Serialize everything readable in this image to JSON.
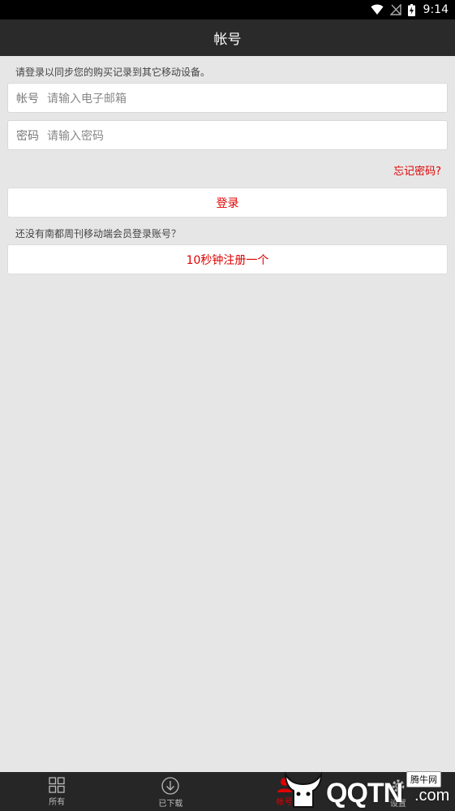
{
  "status_bar": {
    "time": "9:14"
  },
  "header": {
    "title": "帐号"
  },
  "login": {
    "hint": "请登录以同步您的购买记录到其它移动设备。",
    "account_label": "帐号",
    "account_placeholder": "请输入电子邮箱",
    "password_label": "密码",
    "password_placeholder": "请输入密码",
    "forgot_label": "忘记密码?",
    "login_button": "登录"
  },
  "register": {
    "prompt": "还没有南都周刊移动端会员登录账号？",
    "button": "10秒钟注册一个"
  },
  "tab_bar": {
    "items": [
      {
        "label": "所有",
        "icon": "grid-icon"
      },
      {
        "label": "已下载",
        "icon": "download-circle-icon"
      },
      {
        "label": "帐号",
        "icon": "user-icon",
        "active": true
      },
      {
        "label": "设置",
        "icon": "gear-icon"
      }
    ]
  },
  "watermark": {
    "text": "QQTN",
    "suffix": ".com",
    "badge": "腾牛网"
  },
  "colors": {
    "accent": "#e00000",
    "title_bar": "#2a2a2a",
    "background": "#e6e6e6"
  }
}
